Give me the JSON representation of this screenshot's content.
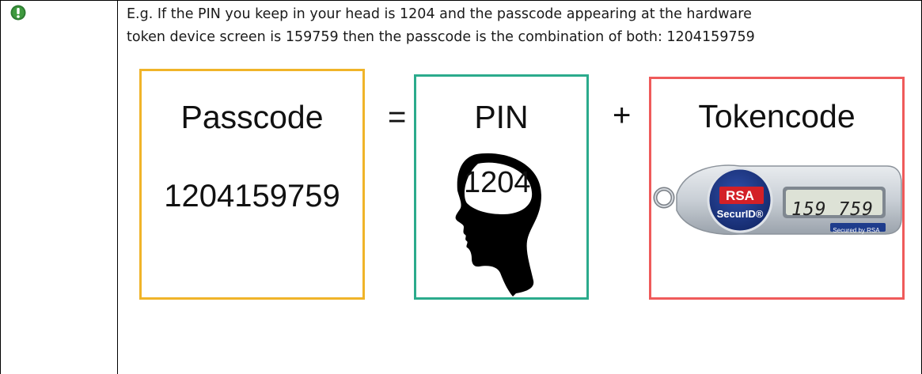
{
  "note": {
    "icon": "exclamation-icon",
    "icon_color": "#2e7d32",
    "line1": "E.g. If the PIN you keep in your head is 1204 and the passcode appearing at the hardware",
    "line2": "token device screen is 159759 then the passcode is the combination of both: 1204159759"
  },
  "diagram": {
    "passcode": {
      "title": "Passcode",
      "value": "1204159759",
      "border_color": "#f0b429"
    },
    "equals": "=",
    "pin": {
      "title": "PIN",
      "value": "1204",
      "border_color": "#2bab8c"
    },
    "plus": "+",
    "token": {
      "title": "Tokencode",
      "display": "159 759",
      "brand": "RSA",
      "product": "SecurID®",
      "secured_by": "Secured by RSA",
      "border_color": "#ef5a5a"
    }
  }
}
